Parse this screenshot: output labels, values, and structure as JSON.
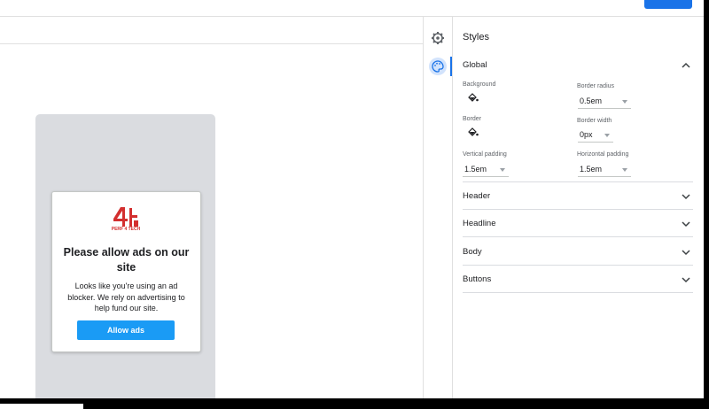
{
  "top_bar": {
    "link_label": "",
    "publish_label": ""
  },
  "preview": {
    "logo_text": "PERF 4 TECH",
    "title": "Please allow ads on our site",
    "body": "Looks like you're using an ad blocker. We rely on advertising to help fund our site.",
    "button_label": "Allow ads"
  },
  "rail": {
    "icons": [
      "gear-icon",
      "palette-icon"
    ]
  },
  "panel": {
    "title": "Styles",
    "global": {
      "label": "Global",
      "background_label": "Background",
      "border_radius_label": "Border radius",
      "border_radius_value": "0.5em",
      "border_label": "Border",
      "border_width_label": "Border width",
      "border_width_value": "0px",
      "vertical_padding_label": "Vertical padding",
      "vertical_padding_value": "1.5em",
      "horizontal_padding_label": "Horizontal padding",
      "horizontal_padding_value": "1.5em"
    },
    "sections": [
      {
        "label": "Header"
      },
      {
        "label": "Headline"
      },
      {
        "label": "Body"
      },
      {
        "label": "Buttons"
      }
    ]
  },
  "colors": {
    "accent": "#1a73e8",
    "allow_button": "#1a9bf5",
    "logo_red": "#d32f2f"
  }
}
